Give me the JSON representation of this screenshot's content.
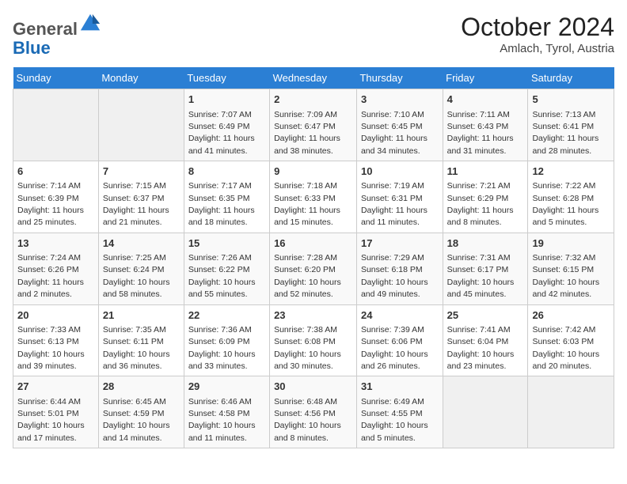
{
  "header": {
    "logo_line1": "General",
    "logo_line2": "Blue",
    "month_year": "October 2024",
    "location": "Amlach, Tyrol, Austria"
  },
  "weekdays": [
    "Sunday",
    "Monday",
    "Tuesday",
    "Wednesday",
    "Thursday",
    "Friday",
    "Saturday"
  ],
  "weeks": [
    [
      {
        "day": "",
        "info": ""
      },
      {
        "day": "",
        "info": ""
      },
      {
        "day": "1",
        "info": "Sunrise: 7:07 AM\nSunset: 6:49 PM\nDaylight: 11 hours and 41 minutes."
      },
      {
        "day": "2",
        "info": "Sunrise: 7:09 AM\nSunset: 6:47 PM\nDaylight: 11 hours and 38 minutes."
      },
      {
        "day": "3",
        "info": "Sunrise: 7:10 AM\nSunset: 6:45 PM\nDaylight: 11 hours and 34 minutes."
      },
      {
        "day": "4",
        "info": "Sunrise: 7:11 AM\nSunset: 6:43 PM\nDaylight: 11 hours and 31 minutes."
      },
      {
        "day": "5",
        "info": "Sunrise: 7:13 AM\nSunset: 6:41 PM\nDaylight: 11 hours and 28 minutes."
      }
    ],
    [
      {
        "day": "6",
        "info": "Sunrise: 7:14 AM\nSunset: 6:39 PM\nDaylight: 11 hours and 25 minutes."
      },
      {
        "day": "7",
        "info": "Sunrise: 7:15 AM\nSunset: 6:37 PM\nDaylight: 11 hours and 21 minutes."
      },
      {
        "day": "8",
        "info": "Sunrise: 7:17 AM\nSunset: 6:35 PM\nDaylight: 11 hours and 18 minutes."
      },
      {
        "day": "9",
        "info": "Sunrise: 7:18 AM\nSunset: 6:33 PM\nDaylight: 11 hours and 15 minutes."
      },
      {
        "day": "10",
        "info": "Sunrise: 7:19 AM\nSunset: 6:31 PM\nDaylight: 11 hours and 11 minutes."
      },
      {
        "day": "11",
        "info": "Sunrise: 7:21 AM\nSunset: 6:29 PM\nDaylight: 11 hours and 8 minutes."
      },
      {
        "day": "12",
        "info": "Sunrise: 7:22 AM\nSunset: 6:28 PM\nDaylight: 11 hours and 5 minutes."
      }
    ],
    [
      {
        "day": "13",
        "info": "Sunrise: 7:24 AM\nSunset: 6:26 PM\nDaylight: 11 hours and 2 minutes."
      },
      {
        "day": "14",
        "info": "Sunrise: 7:25 AM\nSunset: 6:24 PM\nDaylight: 10 hours and 58 minutes."
      },
      {
        "day": "15",
        "info": "Sunrise: 7:26 AM\nSunset: 6:22 PM\nDaylight: 10 hours and 55 minutes."
      },
      {
        "day": "16",
        "info": "Sunrise: 7:28 AM\nSunset: 6:20 PM\nDaylight: 10 hours and 52 minutes."
      },
      {
        "day": "17",
        "info": "Sunrise: 7:29 AM\nSunset: 6:18 PM\nDaylight: 10 hours and 49 minutes."
      },
      {
        "day": "18",
        "info": "Sunrise: 7:31 AM\nSunset: 6:17 PM\nDaylight: 10 hours and 45 minutes."
      },
      {
        "day": "19",
        "info": "Sunrise: 7:32 AM\nSunset: 6:15 PM\nDaylight: 10 hours and 42 minutes."
      }
    ],
    [
      {
        "day": "20",
        "info": "Sunrise: 7:33 AM\nSunset: 6:13 PM\nDaylight: 10 hours and 39 minutes."
      },
      {
        "day": "21",
        "info": "Sunrise: 7:35 AM\nSunset: 6:11 PM\nDaylight: 10 hours and 36 minutes."
      },
      {
        "day": "22",
        "info": "Sunrise: 7:36 AM\nSunset: 6:09 PM\nDaylight: 10 hours and 33 minutes."
      },
      {
        "day": "23",
        "info": "Sunrise: 7:38 AM\nSunset: 6:08 PM\nDaylight: 10 hours and 30 minutes."
      },
      {
        "day": "24",
        "info": "Sunrise: 7:39 AM\nSunset: 6:06 PM\nDaylight: 10 hours and 26 minutes."
      },
      {
        "day": "25",
        "info": "Sunrise: 7:41 AM\nSunset: 6:04 PM\nDaylight: 10 hours and 23 minutes."
      },
      {
        "day": "26",
        "info": "Sunrise: 7:42 AM\nSunset: 6:03 PM\nDaylight: 10 hours and 20 minutes."
      }
    ],
    [
      {
        "day": "27",
        "info": "Sunrise: 6:44 AM\nSunset: 5:01 PM\nDaylight: 10 hours and 17 minutes."
      },
      {
        "day": "28",
        "info": "Sunrise: 6:45 AM\nSunset: 4:59 PM\nDaylight: 10 hours and 14 minutes."
      },
      {
        "day": "29",
        "info": "Sunrise: 6:46 AM\nSunset: 4:58 PM\nDaylight: 10 hours and 11 minutes."
      },
      {
        "day": "30",
        "info": "Sunrise: 6:48 AM\nSunset: 4:56 PM\nDaylight: 10 hours and 8 minutes."
      },
      {
        "day": "31",
        "info": "Sunrise: 6:49 AM\nSunset: 4:55 PM\nDaylight: 10 hours and 5 minutes."
      },
      {
        "day": "",
        "info": ""
      },
      {
        "day": "",
        "info": ""
      }
    ]
  ]
}
